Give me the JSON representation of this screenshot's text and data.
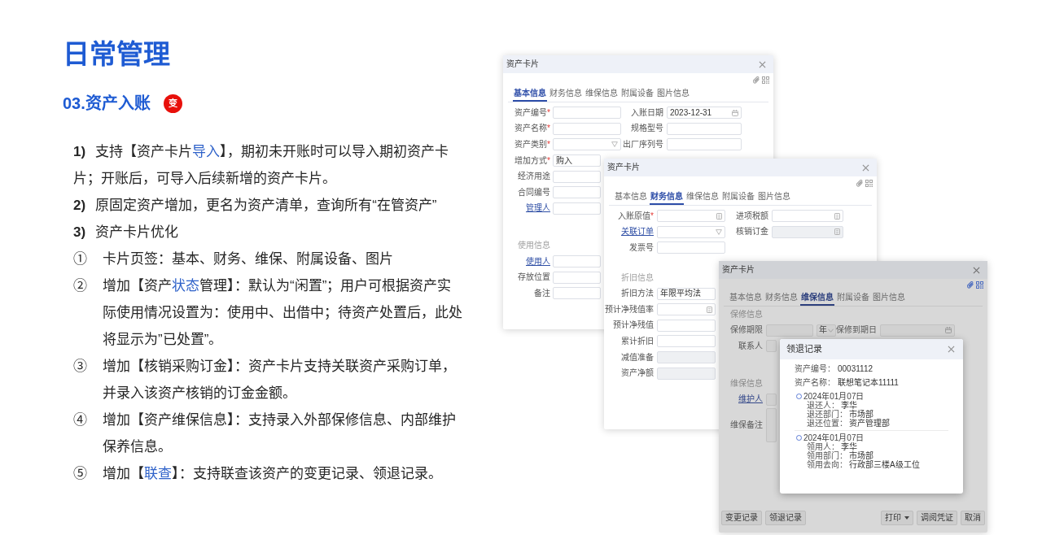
{
  "slide": {
    "title": "日常管理",
    "section_title": "03.资产入账",
    "badge": "变",
    "items": [
      {
        "kind": "numbered",
        "marker": "1)",
        "segments": [
          {
            "text": "支持【资产卡片",
            "highlight": false
          },
          {
            "text": "导入",
            "highlight": true
          },
          {
            "text": "】，期初未开账时可以导入期初资产卡片；开账后，可导入后续新增的资产卡片。",
            "highlight": false
          }
        ]
      },
      {
        "kind": "numbered",
        "marker": "2)",
        "segments": [
          {
            "text": "原固定资产增加，更名为资产清单，查询所有“在管资产”",
            "highlight": false
          }
        ]
      },
      {
        "kind": "numbered",
        "marker": "3)",
        "segments": [
          {
            "text": "资产卡片优化",
            "highlight": false
          }
        ]
      },
      {
        "kind": "circled",
        "marker": "①",
        "segments": [
          {
            "text": "卡片页签：基本、财务、维保、附属设备、图片",
            "highlight": false
          }
        ]
      },
      {
        "kind": "circled",
        "marker": "②",
        "segments": [
          {
            "text": "增加【资产",
            "highlight": false
          },
          {
            "text": "状态",
            "highlight": true
          },
          {
            "text": "管理】：默认为“闲置”；用户可根据资产实际使用情况设置为：使用中、出借中；待资产处置后，此处将显示为”已处置”。",
            "highlight": false
          }
        ]
      },
      {
        "kind": "circled",
        "marker": "③",
        "segments": [
          {
            "text": "增加【核销采购订金】：资产卡片支持关联资产采购订单，并录入该资产核销的订金金额。",
            "highlight": false
          }
        ]
      },
      {
        "kind": "circled",
        "marker": "④",
        "segments": [
          {
            "text": "增加【资产维保信息】：支持录入外部保修信息、内部维护保养信息。",
            "highlight": false
          }
        ]
      },
      {
        "kind": "circled",
        "marker": "⑤",
        "segments": [
          {
            "text": "增加【",
            "highlight": false
          },
          {
            "text": "联查",
            "highlight": true
          },
          {
            "text": "】：支持联查该资产的变更记录、领退记录。",
            "highlight": false
          }
        ]
      }
    ]
  },
  "windows": [
    {
      "title": "资产卡片",
      "dimmed": false,
      "tabs": [
        {
          "label": "基本信息",
          "selected": true
        },
        {
          "label": "财务信息",
          "selected": false
        },
        {
          "label": "维保信息",
          "selected": false
        },
        {
          "label": "附属设备",
          "selected": false
        },
        {
          "label": "图片信息",
          "selected": false
        }
      ],
      "rows": [
        {
          "kind": "fields",
          "fields": [
            {
              "label": "资产编号",
              "required_mark": "*",
              "link": false,
              "input": {
                "kind": "text",
                "disabled": false
              }
            },
            {
              "label": "入账日期",
              "link": false,
              "input": {
                "kind": "date",
                "value": "2023-12-31",
                "disabled": false
              }
            }
          ]
        },
        {
          "kind": "fields",
          "fields": [
            {
              "label": "资产名称",
              "required_mark": "*",
              "link": false,
              "input": {
                "kind": "text",
                "disabled": false
              }
            },
            {
              "label": "规格型号",
              "link": false,
              "input": {
                "kind": "text",
                "disabled": false
              }
            }
          ]
        },
        {
          "kind": "fields",
          "fields": [
            {
              "label": "资产类别",
              "required_mark": "*",
              "link": false,
              "input": {
                "kind": "select",
                "disabled": false
              }
            },
            {
              "label": "出厂序列号",
              "link": false,
              "input": {
                "kind": "text",
                "disabled": false
              }
            }
          ]
        },
        {
          "kind": "fields",
          "fields": [
            {
              "label": "增加方式",
              "required_mark": "*",
              "link": false,
              "input": {
                "kind": "text",
                "value": "购入",
                "disabled": false
              }
            }
          ]
        },
        {
          "kind": "fields",
          "fields": [
            {
              "label": "经济用途",
              "link": false,
              "input": {
                "kind": "text",
                "disabled": false
              }
            }
          ]
        },
        {
          "kind": "fields",
          "fields": [
            {
              "label": "合同编号",
              "link": false,
              "input": {
                "kind": "text",
                "disabled": false
              }
            }
          ]
        },
        {
          "kind": "fields",
          "fields": [
            {
              "label": "管理人",
              "link": true,
              "input": {
                "kind": "text",
                "disabled": false
              }
            }
          ]
        },
        {
          "kind": "section",
          "label": "使用信息"
        },
        {
          "kind": "fields",
          "fields": [
            {
              "label": "使用人",
              "link": true,
              "input": {
                "kind": "text",
                "disabled": false
              }
            }
          ]
        },
        {
          "kind": "fields",
          "fields": [
            {
              "label": "存放位置",
              "link": false,
              "input": {
                "kind": "text",
                "disabled": false
              }
            }
          ]
        },
        {
          "kind": "fields",
          "fields": [
            {
              "label": "备注",
              "link": false,
              "input": {
                "kind": "text",
                "disabled": false
              }
            }
          ]
        }
      ]
    },
    {
      "title": "资产卡片",
      "dimmed": false,
      "tabs": [
        {
          "label": "基本信息",
          "selected": false
        },
        {
          "label": "财务信息",
          "selected": true
        },
        {
          "label": "维保信息",
          "selected": false
        },
        {
          "label": "附属设备",
          "selected": false
        },
        {
          "label": "图片信息",
          "selected": false
        }
      ],
      "rows": [
        {
          "kind": "fields",
          "fields": [
            {
              "label": "入账原值",
              "required_mark": "*",
              "link": false,
              "input": {
                "kind": "number",
                "disabled": false
              }
            },
            {
              "label": "进项税额",
              "link": false,
              "input": {
                "kind": "number",
                "disabled": false
              }
            }
          ]
        },
        {
          "kind": "fields",
          "fields": [
            {
              "label": "关联订单",
              "link": true,
              "input": {
                "kind": "select",
                "disabled": false
              }
            },
            {
              "label": "核销订金",
              "link": false,
              "input": {
                "kind": "number",
                "disabled": true
              }
            }
          ]
        },
        {
          "kind": "fields",
          "fields": [
            {
              "label": "发票号",
              "link": false,
              "input": {
                "kind": "text",
                "disabled": false
              }
            }
          ]
        },
        {
          "kind": "section",
          "label": "折旧信息"
        },
        {
          "kind": "fields",
          "fields": [
            {
              "label": "折旧方法",
              "link": false,
              "input": {
                "kind": "text",
                "value": "年限平均法",
                "disabled": false
              }
            }
          ]
        },
        {
          "kind": "fields",
          "fields": [
            {
              "label": "预计净残值率",
              "link": false,
              "input": {
                "kind": "number",
                "disabled": false
              }
            }
          ]
        },
        {
          "kind": "fields",
          "fields": [
            {
              "label": "预计净残值",
              "link": false,
              "input": {
                "kind": "text",
                "disabled": false
              }
            }
          ]
        },
        {
          "kind": "fields",
          "fields": [
            {
              "label": "累计折旧",
              "link": false,
              "input": {
                "kind": "text",
                "disabled": false
              }
            }
          ]
        },
        {
          "kind": "fields",
          "fields": [
            {
              "label": "减值准备",
              "link": false,
              "input": {
                "kind": "text",
                "disabled": true
              }
            }
          ]
        },
        {
          "kind": "fields",
          "fields": [
            {
              "label": "资产净额",
              "link": false,
              "input": {
                "kind": "text",
                "disabled": true
              }
            }
          ]
        }
      ]
    },
    {
      "title": "资产卡片",
      "dimmed": true,
      "tabs": [
        {
          "label": "基本信息",
          "selected": false
        },
        {
          "label": "财务信息",
          "selected": false
        },
        {
          "label": "维保信息",
          "selected": true
        },
        {
          "label": "附属设备",
          "selected": false
        },
        {
          "label": "图片信息",
          "selected": false
        }
      ],
      "rows": [
        {
          "kind": "section",
          "label": "保修信息"
        },
        {
          "kind": "fields",
          "fields": [
            {
              "label": "保修期限",
              "link": false,
              "input": {
                "kind": "text",
                "disabled": false
              },
              "unit": "年"
            },
            {
              "label": "保修到期日",
              "link": false,
              "input": {
                "kind": "date",
                "disabled": false
              }
            }
          ]
        },
        {
          "kind": "fields",
          "fields": [
            {
              "label": "联系人",
              "link": false,
              "input": {
                "kind": "text",
                "disabled": false
              }
            }
          ]
        },
        {
          "kind": "section",
          "label": "维保信息"
        },
        {
          "kind": "fields",
          "fields": [
            {
              "label": "维护人",
              "link": true,
              "input": {
                "kind": "text",
                "disabled": false
              }
            }
          ]
        },
        {
          "kind": "fields",
          "fields": [
            {
              "label": "维保备注",
              "link": false,
              "input": {
                "kind": "textarea",
                "disabled": false
              }
            }
          ]
        }
      ],
      "footer": {
        "left": [
          {
            "label": "变更记录",
            "kind": "button"
          },
          {
            "label": "领退记录",
            "kind": "button"
          }
        ],
        "right": [
          {
            "label": "打印",
            "kind": "split"
          },
          {
            "label": "调阅凭证",
            "kind": "button"
          },
          {
            "label": "取消",
            "kind": "button"
          }
        ]
      },
      "dialog": {
        "title": "领退记录",
        "fields": [
          {
            "label": "资产编号：",
            "value": "00031112"
          },
          {
            "label": "资产名称：",
            "value": "联想笔记本11111"
          }
        ],
        "timeline": [
          {
            "date": "2024年01月07日",
            "fields": [
              {
                "label": "退还人：",
                "value": "李华"
              },
              {
                "label": "退还部门：",
                "value": "市场部"
              },
              {
                "label": "退还位置：",
                "value": "资产管理部"
              }
            ]
          },
          {
            "date": "2024年01月07日",
            "fields": [
              {
                "label": "领用人：",
                "value": "李华"
              },
              {
                "label": "领用部门：",
                "value": "市场部"
              },
              {
                "label": "领用去向：",
                "value": "行政部三楼A级工位"
              }
            ]
          }
        ]
      }
    }
  ]
}
